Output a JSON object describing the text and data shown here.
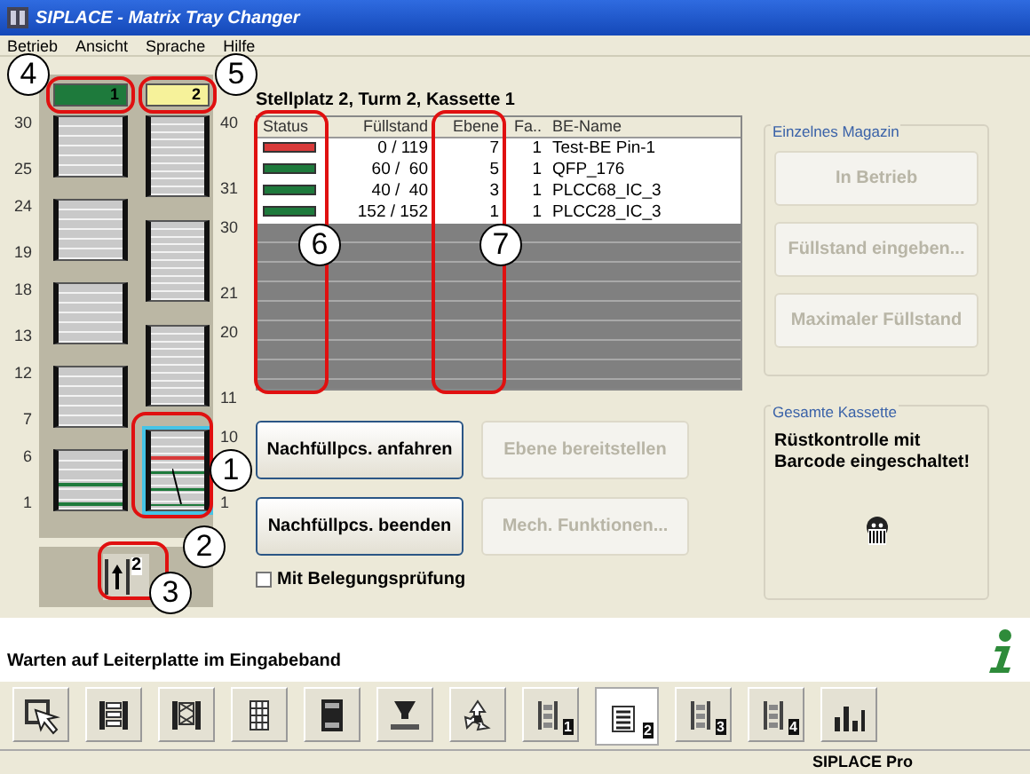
{
  "window": {
    "title": "SIPLACE - Matrix Tray Changer"
  },
  "menu": [
    {
      "label": "Betrieb"
    },
    {
      "label": "Ansicht"
    },
    {
      "label": "Sprache"
    },
    {
      "label": "Hilfe"
    }
  ],
  "towers": [
    {
      "label": "1",
      "color": "#1e7a3c",
      "cassettes": [
        {
          "top_label": "30",
          "bottom_label": "25",
          "selected": false
        },
        {
          "top_label": "24",
          "bottom_label": "19",
          "selected": false
        },
        {
          "top_label": "18",
          "bottom_label": "13",
          "selected": false
        },
        {
          "top_label": "12",
          "bottom_label": "7",
          "selected": false
        },
        {
          "top_label": "6",
          "bottom_label": "1",
          "selected": false,
          "slots": [
            {
              "tray": false
            },
            {
              "tray": false
            },
            {
              "tray": false
            },
            {
              "tray": true,
              "color": "#1e7a3c"
            },
            {
              "tray": false
            },
            {
              "tray": true,
              "color": "#1e7a3c"
            }
          ]
        }
      ]
    },
    {
      "label": "2",
      "color": "#f6f29a",
      "cassettes": [
        {
          "top_label": "40",
          "bottom_label": "31",
          "selected": false
        },
        {
          "top_label": "30",
          "bottom_label": "21",
          "selected": false
        },
        {
          "top_label": "20",
          "bottom_label": "11",
          "selected": false
        },
        {
          "top_label": "10",
          "bottom_label": "1",
          "selected": true,
          "slots": [
            {
              "tray": false
            },
            {
              "tray": false
            },
            {
              "tray": false
            },
            {
              "tray": true,
              "color": "#d83a3a"
            },
            {
              "tray": false
            },
            {
              "tray": true,
              "color": "#1e7a3c"
            },
            {
              "tray": false
            },
            {
              "tray": true,
              "color": "#1e7a3c"
            },
            {
              "tray": false
            },
            {
              "tray": true,
              "color": "#1e7a3c"
            }
          ]
        }
      ]
    }
  ],
  "tower_button": {
    "badge": "2"
  },
  "location_title": "Stellplatz 2, Turm 2, Kassette 1",
  "table": {
    "columns": [
      "Status",
      "Füllstand",
      "Ebene",
      "Fa..",
      "BE-Name"
    ],
    "rows": [
      {
        "color": "#d83a3a",
        "fill": "0 / 119",
        "ebene": "7",
        "fa": "1",
        "name": "Test-BE Pin-1"
      },
      {
        "color": "#1e7a3c",
        "fill": "60 /  60",
        "ebene": "5",
        "fa": "1",
        "name": "QFP_176"
      },
      {
        "color": "#1e7a3c",
        "fill": "40 /  40",
        "ebene": "3",
        "fa": "1",
        "name": "PLCC68_IC_3"
      },
      {
        "color": "#1e7a3c",
        "fill": "152 / 152",
        "ebene": "1",
        "fa": "1",
        "name": "PLCC28_IC_3"
      }
    ]
  },
  "buttons": [
    {
      "label": "Nachfüllpcs. anfahren",
      "disabled": false
    },
    {
      "label": "Ebene bereitstellen",
      "disabled": true
    },
    {
      "label": "Nachfüllpcs. beenden",
      "disabled": false
    },
    {
      "label": "Mech. Funktionen...",
      "disabled": true
    }
  ],
  "checkbox": {
    "label": "Mit Belegungsprüfung",
    "checked": false
  },
  "single_magazine": {
    "title": "Einzelnes Magazin",
    "buttons": [
      {
        "label": "In Betrieb",
        "disabled": true
      },
      {
        "label": "Füllstand eingeben...",
        "disabled": true
      },
      {
        "label": "Maximaler Füllstand",
        "disabled": true
      }
    ]
  },
  "whole_cassette": {
    "title": "Gesamte Kassette",
    "message": "Rüstkontrolle mit Barcode eingeschaltet!"
  },
  "message": "Warten auf Leiterplatte im Eingabeband",
  "toolbar": [
    {
      "kind": "pointer",
      "selected": false
    },
    {
      "kind": "tray-grid",
      "selected": false
    },
    {
      "kind": "tray-cross",
      "selected": false
    },
    {
      "kind": "grid",
      "selected": false
    },
    {
      "kind": "cassette",
      "selected": false
    },
    {
      "kind": "press",
      "selected": false
    },
    {
      "kind": "recycle",
      "selected": false
    },
    {
      "kind": "tower",
      "badge": "1",
      "selected": false
    },
    {
      "kind": "list",
      "badge": "2",
      "selected": true
    },
    {
      "kind": "tower",
      "badge": "3",
      "selected": false
    },
    {
      "kind": "tower",
      "badge": "4",
      "selected": false
    },
    {
      "kind": "bars",
      "selected": false
    }
  ],
  "status_bar": "SIPLACE Pro",
  "annotations": [
    {
      "label": "1"
    },
    {
      "label": "2"
    },
    {
      "label": "3"
    },
    {
      "label": "4"
    },
    {
      "label": "5"
    },
    {
      "label": "6"
    },
    {
      "label": "7"
    }
  ]
}
